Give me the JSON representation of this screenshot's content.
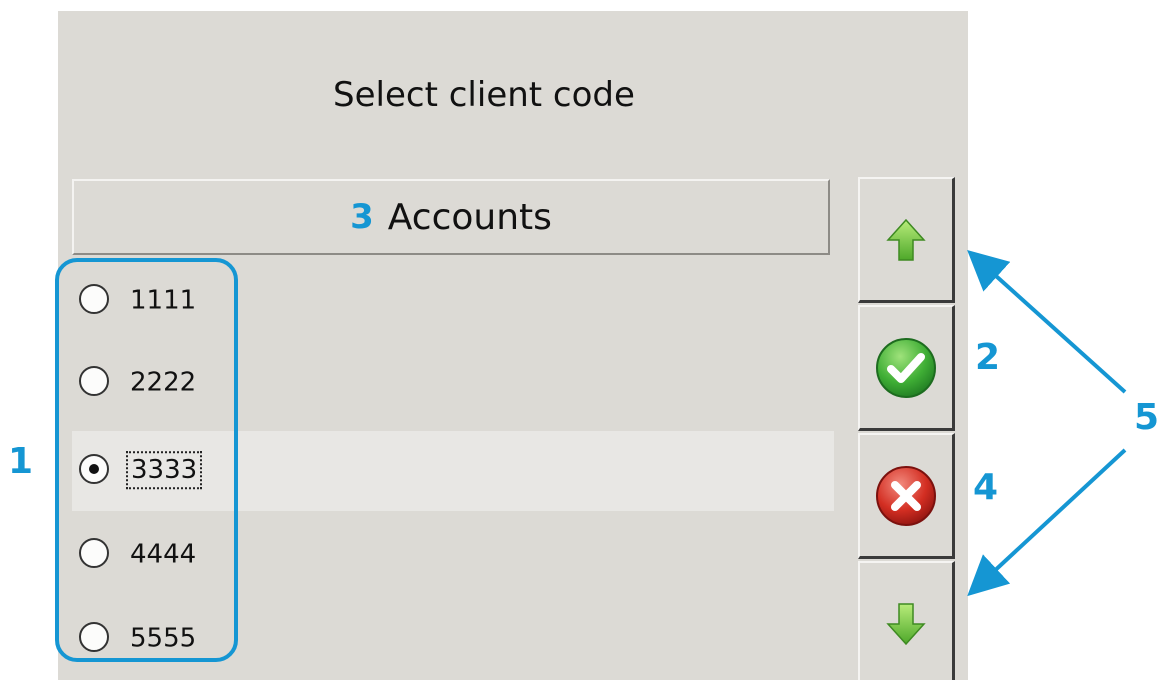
{
  "dialog": {
    "title": "Select client code",
    "list_header": "Accounts",
    "accounts": [
      {
        "code": "1111",
        "selected": false
      },
      {
        "code": "2222",
        "selected": false
      },
      {
        "code": "3333",
        "selected": true
      },
      {
        "code": "4444",
        "selected": false
      },
      {
        "code": "5555",
        "selected": false
      }
    ],
    "buttons": [
      {
        "icon": "arrow-up-icon",
        "color": "#6cc43a"
      },
      {
        "icon": "check-circle-icon",
        "color": "#3aa53a"
      },
      {
        "icon": "x-circle-icon",
        "color": "#d62b22"
      },
      {
        "icon": "arrow-down-icon",
        "color": "#6cc43a"
      }
    ]
  },
  "annotations": {
    "marker_1": "1",
    "marker_2": "2",
    "marker_3": "3",
    "marker_4": "4",
    "marker_5": "5",
    "color": "#1596d3"
  }
}
